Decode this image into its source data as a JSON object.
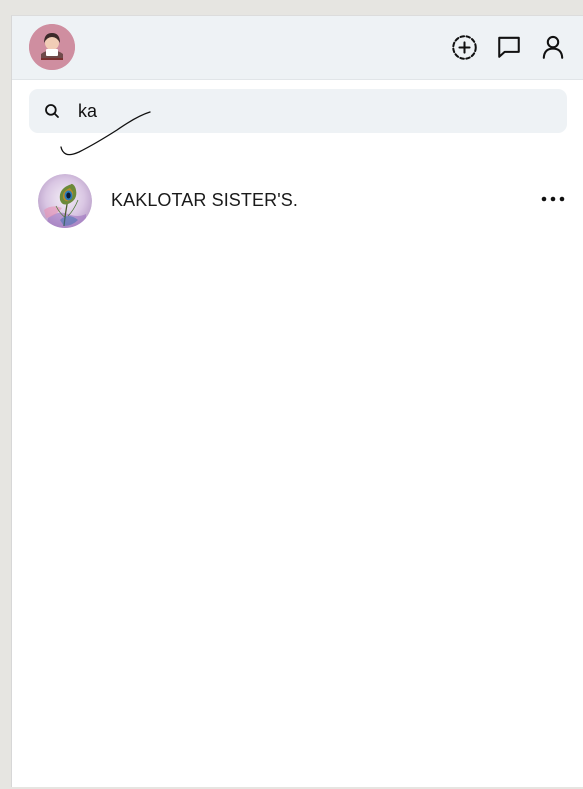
{
  "header": {
    "icons": {
      "create": "add-story-icon",
      "messages": "chat-icon",
      "profile": "profile-icon"
    }
  },
  "search": {
    "value": "ka",
    "icon": "search-icon"
  },
  "results": [
    {
      "name": "KAKLOTAR SISTER'S.",
      "more_icon": "more-horizontal-icon"
    }
  ],
  "colors": {
    "header_bg": "#eef2f5",
    "search_bg": "#eef2f5",
    "panel_bg": "#ffffff",
    "page_bg": "#e6e5e1"
  }
}
